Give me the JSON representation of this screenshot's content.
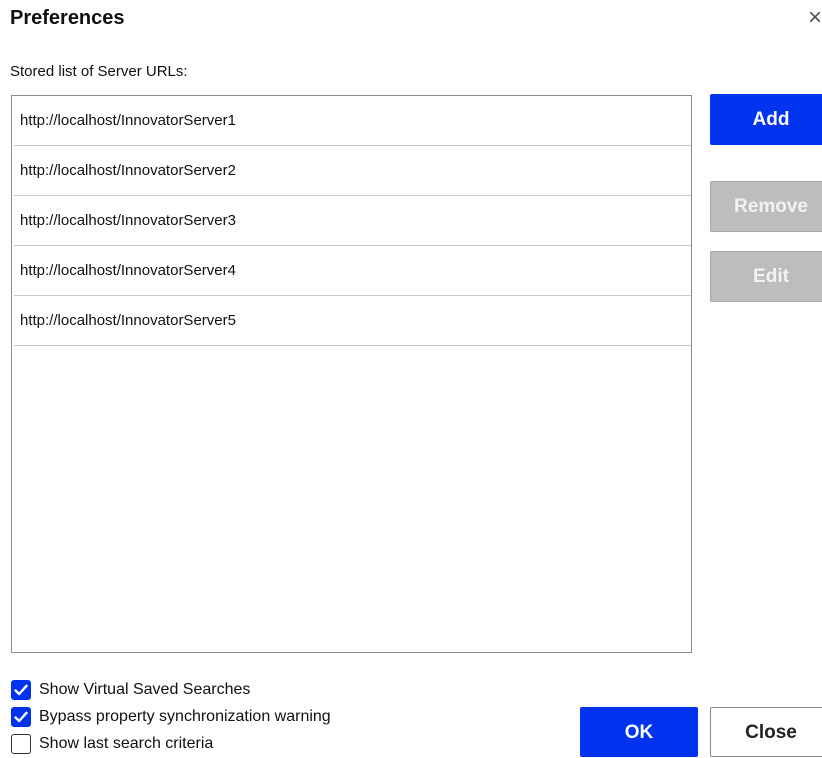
{
  "dialog": {
    "title": "Preferences",
    "close_glyph": "×"
  },
  "server_list": {
    "label": "Stored list of Server URLs:",
    "items": [
      "http://localhost/InnovatorServer1",
      "http://localhost/InnovatorServer2",
      "http://localhost/InnovatorServer3",
      "http://localhost/InnovatorServer4",
      "http://localhost/InnovatorServer5"
    ]
  },
  "actions": {
    "add": "Add",
    "remove": "Remove",
    "edit": "Edit"
  },
  "options": [
    {
      "label": "Show Virtual Saved Searches",
      "checked": true
    },
    {
      "label": "Bypass property synchronization warning",
      "checked": true
    },
    {
      "label": "Show last search criteria",
      "checked": false
    }
  ],
  "footer": {
    "ok": "OK",
    "close": "Close"
  },
  "colors": {
    "accent": "#0033ee",
    "disabled": "#bdbdbd"
  },
  "icons": {
    "close": "close-icon",
    "check": "checkmark-icon"
  }
}
